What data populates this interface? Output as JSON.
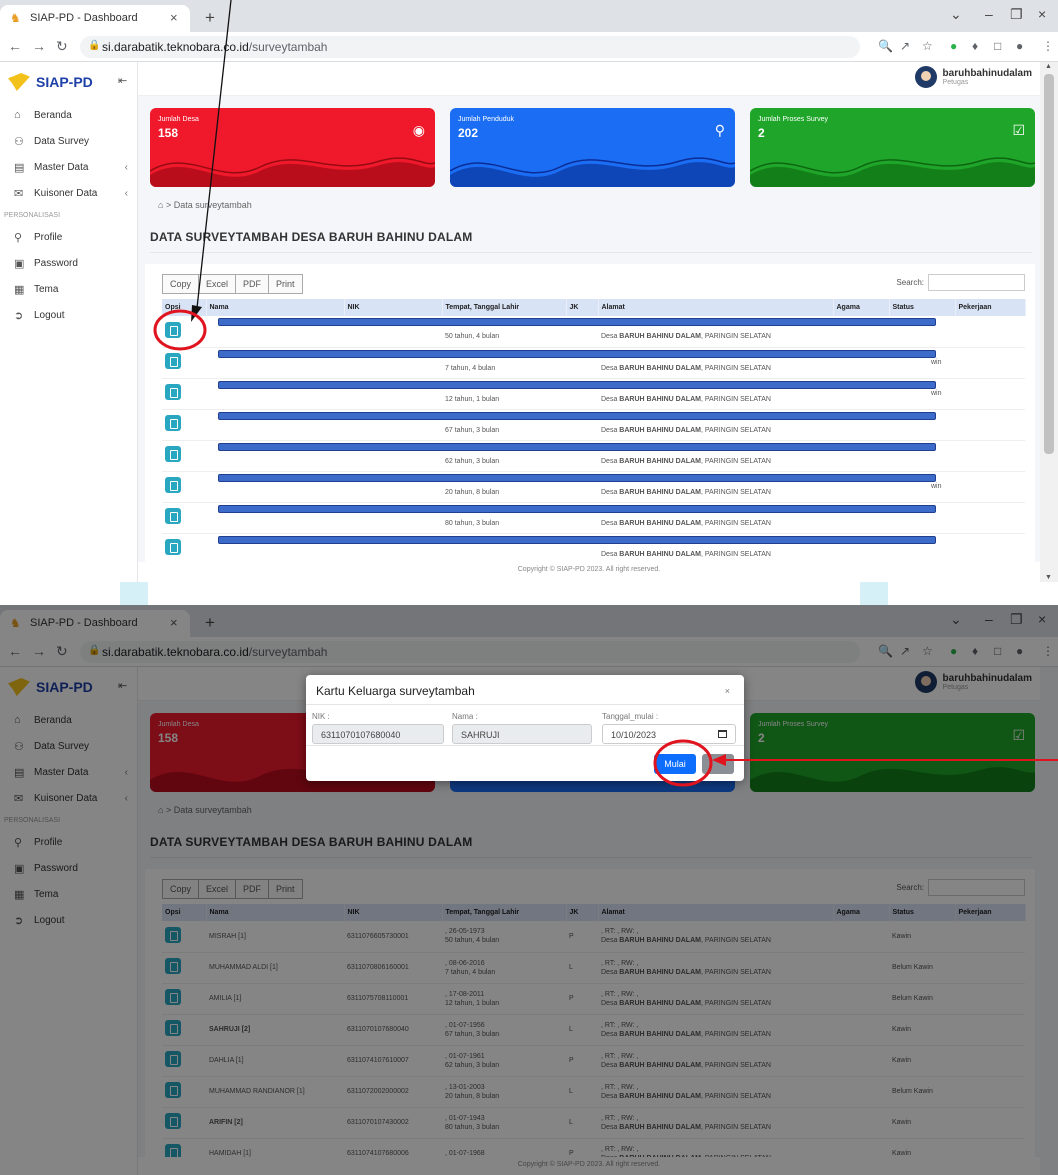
{
  "browser": {
    "tab_title": "SIAP-PD - Dashboard",
    "url_host": "si.darabatik.teknobara.co.id",
    "url_path": "/surveytambah"
  },
  "app": {
    "brand": "SIAP-PD",
    "user_name": "baruhbahinudalam",
    "user_role": "Petugas"
  },
  "sidebar": {
    "items": [
      {
        "label": "Beranda",
        "icon": "home-icon"
      },
      {
        "label": "Data Survey",
        "icon": "users-icon"
      },
      {
        "label": "Master Data",
        "icon": "folder-icon",
        "has_submenu": true
      },
      {
        "label": "Kuisoner Data",
        "icon": "mail-icon",
        "has_submenu": true
      }
    ],
    "section": "PERSONALISASI",
    "personal": [
      {
        "label": "Profile",
        "icon": "user-icon"
      },
      {
        "label": "Password",
        "icon": "lock-icon"
      },
      {
        "label": "Tema",
        "icon": "grid-icon"
      },
      {
        "label": "Logout",
        "icon": "logout-icon"
      }
    ]
  },
  "cards": [
    {
      "label": "Jumlah Desa",
      "value": "158",
      "color": "#f0192b",
      "icon": "pin-icon"
    },
    {
      "label": "Jumlah Penduduk",
      "value": "202",
      "color": "#1b6ef3",
      "icon": "person-icon"
    },
    {
      "label": "Jumlah Proses Survey",
      "value": "2",
      "color": "#1fa62a",
      "icon": "check-icon"
    }
  ],
  "breadcrumb": "Data surveytambah",
  "page_title": "DATA SURVEYTAMBAH DESA BARUH BAHINU DALAM",
  "export_buttons": [
    "Copy",
    "Excel",
    "PDF",
    "Print"
  ],
  "search_label": "Search:",
  "table": {
    "columns": [
      "Opsi",
      "Nama",
      "NIK",
      "Tempat, Tanggal Lahir",
      "JK",
      "Alamat",
      "Agama",
      "Status",
      "Pekerjaan"
    ],
    "rows": [
      {
        "nama": "MISRAH [1]",
        "bold": false,
        "nik": "6311076605730001",
        "ttl": ", 26-05-1973",
        "umur": "50 tahun, 4 bulan",
        "jk": "P",
        "status": "Kawin"
      },
      {
        "nama": "MUHAMMAD ALDI [1]",
        "bold": false,
        "nik": "6311070806160001",
        "ttl": ", 08-06-2016",
        "umur": "7 tahun, 4 bulan",
        "jk": "L",
        "status": "Belum Kawin"
      },
      {
        "nama": "AMILIA [1]",
        "bold": false,
        "nik": "6311075708110001",
        "ttl": ", 17-08-2011",
        "umur": "12 tahun, 1 bulan",
        "jk": "P",
        "status": "Belum Kawin"
      },
      {
        "nama": "SAHRUJI [2]",
        "bold": true,
        "nik": "6311070107680040",
        "ttl": ", 01-07-1956",
        "umur": "67 tahun, 3 bulan",
        "jk": "L",
        "status": "Kawin"
      },
      {
        "nama": "DAHLIA [1]",
        "bold": false,
        "nik": "6311074107610007",
        "ttl": ", 01-07-1961",
        "umur": "62 tahun, 3 bulan",
        "jk": "P",
        "status": "Kawin"
      },
      {
        "nama": "MUHAMMAD RANDIANOR [1]",
        "bold": false,
        "nik": "6311072002000002",
        "ttl": ", 13-01-2003",
        "umur": "20 tahun, 8 bulan",
        "jk": "L",
        "status": "Belum Kawin"
      },
      {
        "nama": "ARIFIN [2]",
        "bold": true,
        "nik": "6311070107430002",
        "ttl": ", 01-07-1943",
        "umur": "80 tahun, 3 bulan",
        "jk": "L",
        "status": "Kawin"
      },
      {
        "nama": "HAMIDAH [1]",
        "bold": false,
        "nik": "6311074107680006",
        "ttl": ", 01-07-1968",
        "umur": "",
        "jk": "P",
        "status": "Kawin"
      }
    ],
    "addr_rtrw": ", RT: , RW: ,",
    "addr_desa_prefix": "Desa",
    "addr_desa": "BARUH BAHINU DALAM",
    "addr_kec": ", PARINGIN SELATAN",
    "status_fragment": "win"
  },
  "footer": "Copyright © SIAP-PD 2023. All right reserved.",
  "modal": {
    "title": "Kartu Keluarga surveytambah",
    "nik_label": "NIK :",
    "nik_value": "6311070107680040",
    "nama_label": "Nama :",
    "nama_value": "SAHRUJI",
    "tanggal_label": "Tanggal_mulai :",
    "tanggal_value": "10/10/2023",
    "start_button": "Mulai"
  },
  "colors": {
    "annotation_red": "#e0141e",
    "table_header": "#d8e3f6",
    "opsi_button": "#2aa7c0"
  }
}
